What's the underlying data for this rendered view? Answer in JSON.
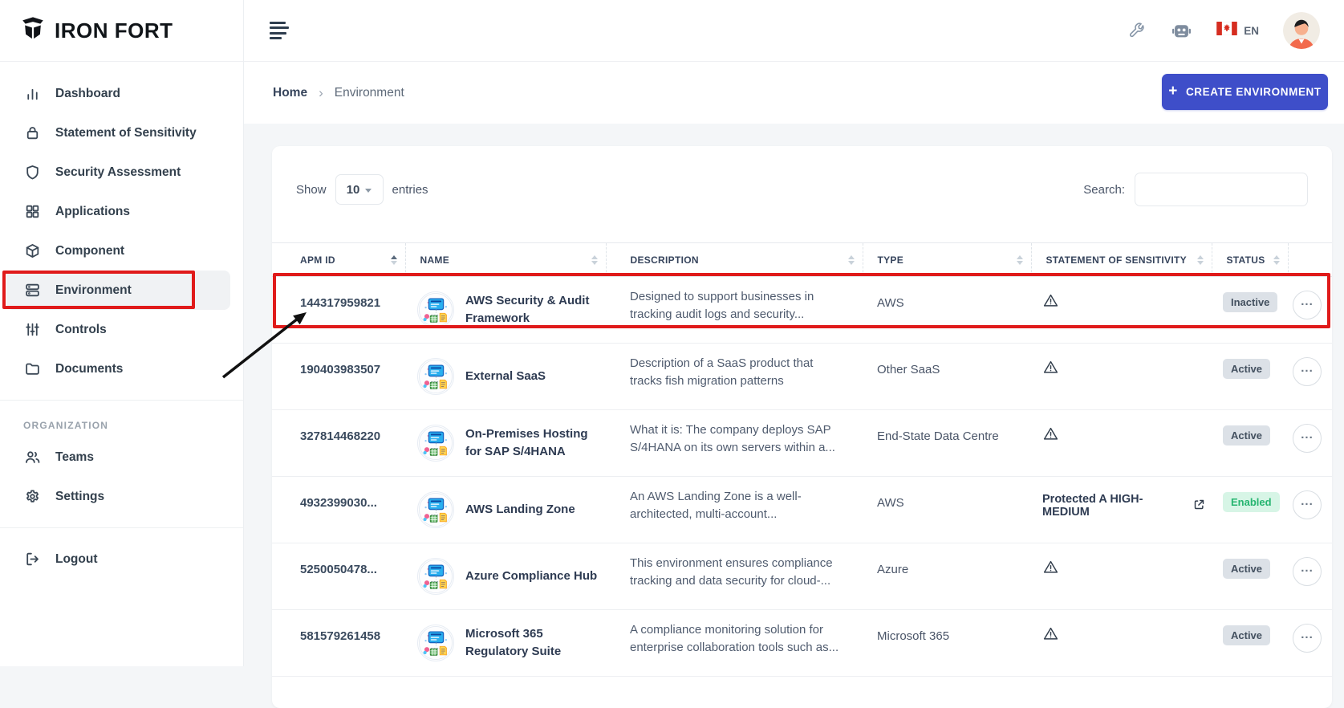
{
  "brand": {
    "name": "IRON FORT"
  },
  "header": {
    "language": "EN"
  },
  "breadcrumb": {
    "home": "Home",
    "separator": "›",
    "current": "Environment"
  },
  "create_button": {
    "plus": "+",
    "label": "CREATE ENVIRONMENT"
  },
  "table_controls": {
    "show_label": "Show",
    "page_size": "10",
    "entries_label": "entries",
    "search_label": "Search:",
    "search_value": ""
  },
  "sidebar": {
    "items": [
      {
        "label": "Dashboard",
        "icon": "bar-chart",
        "active": false
      },
      {
        "label": "Statement of Sensitivity",
        "icon": "lock",
        "active": false
      },
      {
        "label": "Security Assessment",
        "icon": "shield",
        "active": false
      },
      {
        "label": "Applications",
        "icon": "grid",
        "active": false
      },
      {
        "label": "Component",
        "icon": "box",
        "active": false
      },
      {
        "label": "Environment",
        "icon": "server",
        "active": true
      },
      {
        "label": "Controls",
        "icon": "sliders",
        "active": false
      },
      {
        "label": "Documents",
        "icon": "folder",
        "active": false
      }
    ],
    "section_label": "ORGANIZATION",
    "org_items": [
      {
        "label": "Teams",
        "icon": "users"
      },
      {
        "label": "Settings",
        "icon": "gear"
      }
    ],
    "logout": {
      "label": "Logout"
    }
  },
  "table": {
    "columns": [
      {
        "label": "APM ID",
        "sorted": "asc"
      },
      {
        "label": "NAME",
        "sorted": ""
      },
      {
        "label": "DESCRIPTION",
        "sorted": ""
      },
      {
        "label": "TYPE",
        "sorted": ""
      },
      {
        "label": "STATEMENT OF SENSITIVITY",
        "sorted": ""
      },
      {
        "label": "STATUS",
        "sorted": ""
      }
    ],
    "row_actions_glyph": "...",
    "rows": [
      {
        "apm_id": "144317959821",
        "name": "AWS Security & Audit Framework",
        "description": "Designed to support businesses in tracking audit logs and security...",
        "type": "AWS",
        "sos": "warning",
        "sos_text": "",
        "status": "Inactive",
        "status_kind": "gray"
      },
      {
        "apm_id": "190403983507",
        "name": "External SaaS",
        "description": "Description of a SaaS product that tracks fish migration patterns",
        "type": "Other SaaS",
        "sos": "warning",
        "sos_text": "",
        "status": "Active",
        "status_kind": "gray"
      },
      {
        "apm_id": "327814468220",
        "name": "On-Premises Hosting for SAP S/4HANA",
        "description": "What it is: The company deploys SAP S/4HANA on its own servers within a...",
        "type": "End-State Data Centre",
        "sos": "warning",
        "sos_text": "",
        "status": "Active",
        "status_kind": "gray"
      },
      {
        "apm_id": "4932399030...",
        "name": "AWS Landing Zone",
        "description": "An AWS Landing Zone is a well-architected, multi-account...",
        "type": "AWS",
        "sos": "link",
        "sos_text": "Protected A HIGH- MEDIUM",
        "status": "Enabled",
        "status_kind": "green"
      },
      {
        "apm_id": "5250050478...",
        "name": "Azure Compliance Hub",
        "description": "This environment ensures compliance tracking and data security for cloud-...",
        "type": "Azure",
        "sos": "warning",
        "sos_text": "",
        "status": "Active",
        "status_kind": "gray"
      },
      {
        "apm_id": "581579261458",
        "name": "Microsoft 365 Regulatory Suite",
        "description": "A compliance monitoring solution for enterprise collaboration tools such as...",
        "type": "Microsoft 365",
        "sos": "warning",
        "sos_text": "",
        "status": "Active",
        "status_kind": "gray"
      }
    ]
  },
  "annotations": {
    "color": "#e01a1a",
    "sidebar_target": "Environment",
    "row_target": "144317959821"
  }
}
